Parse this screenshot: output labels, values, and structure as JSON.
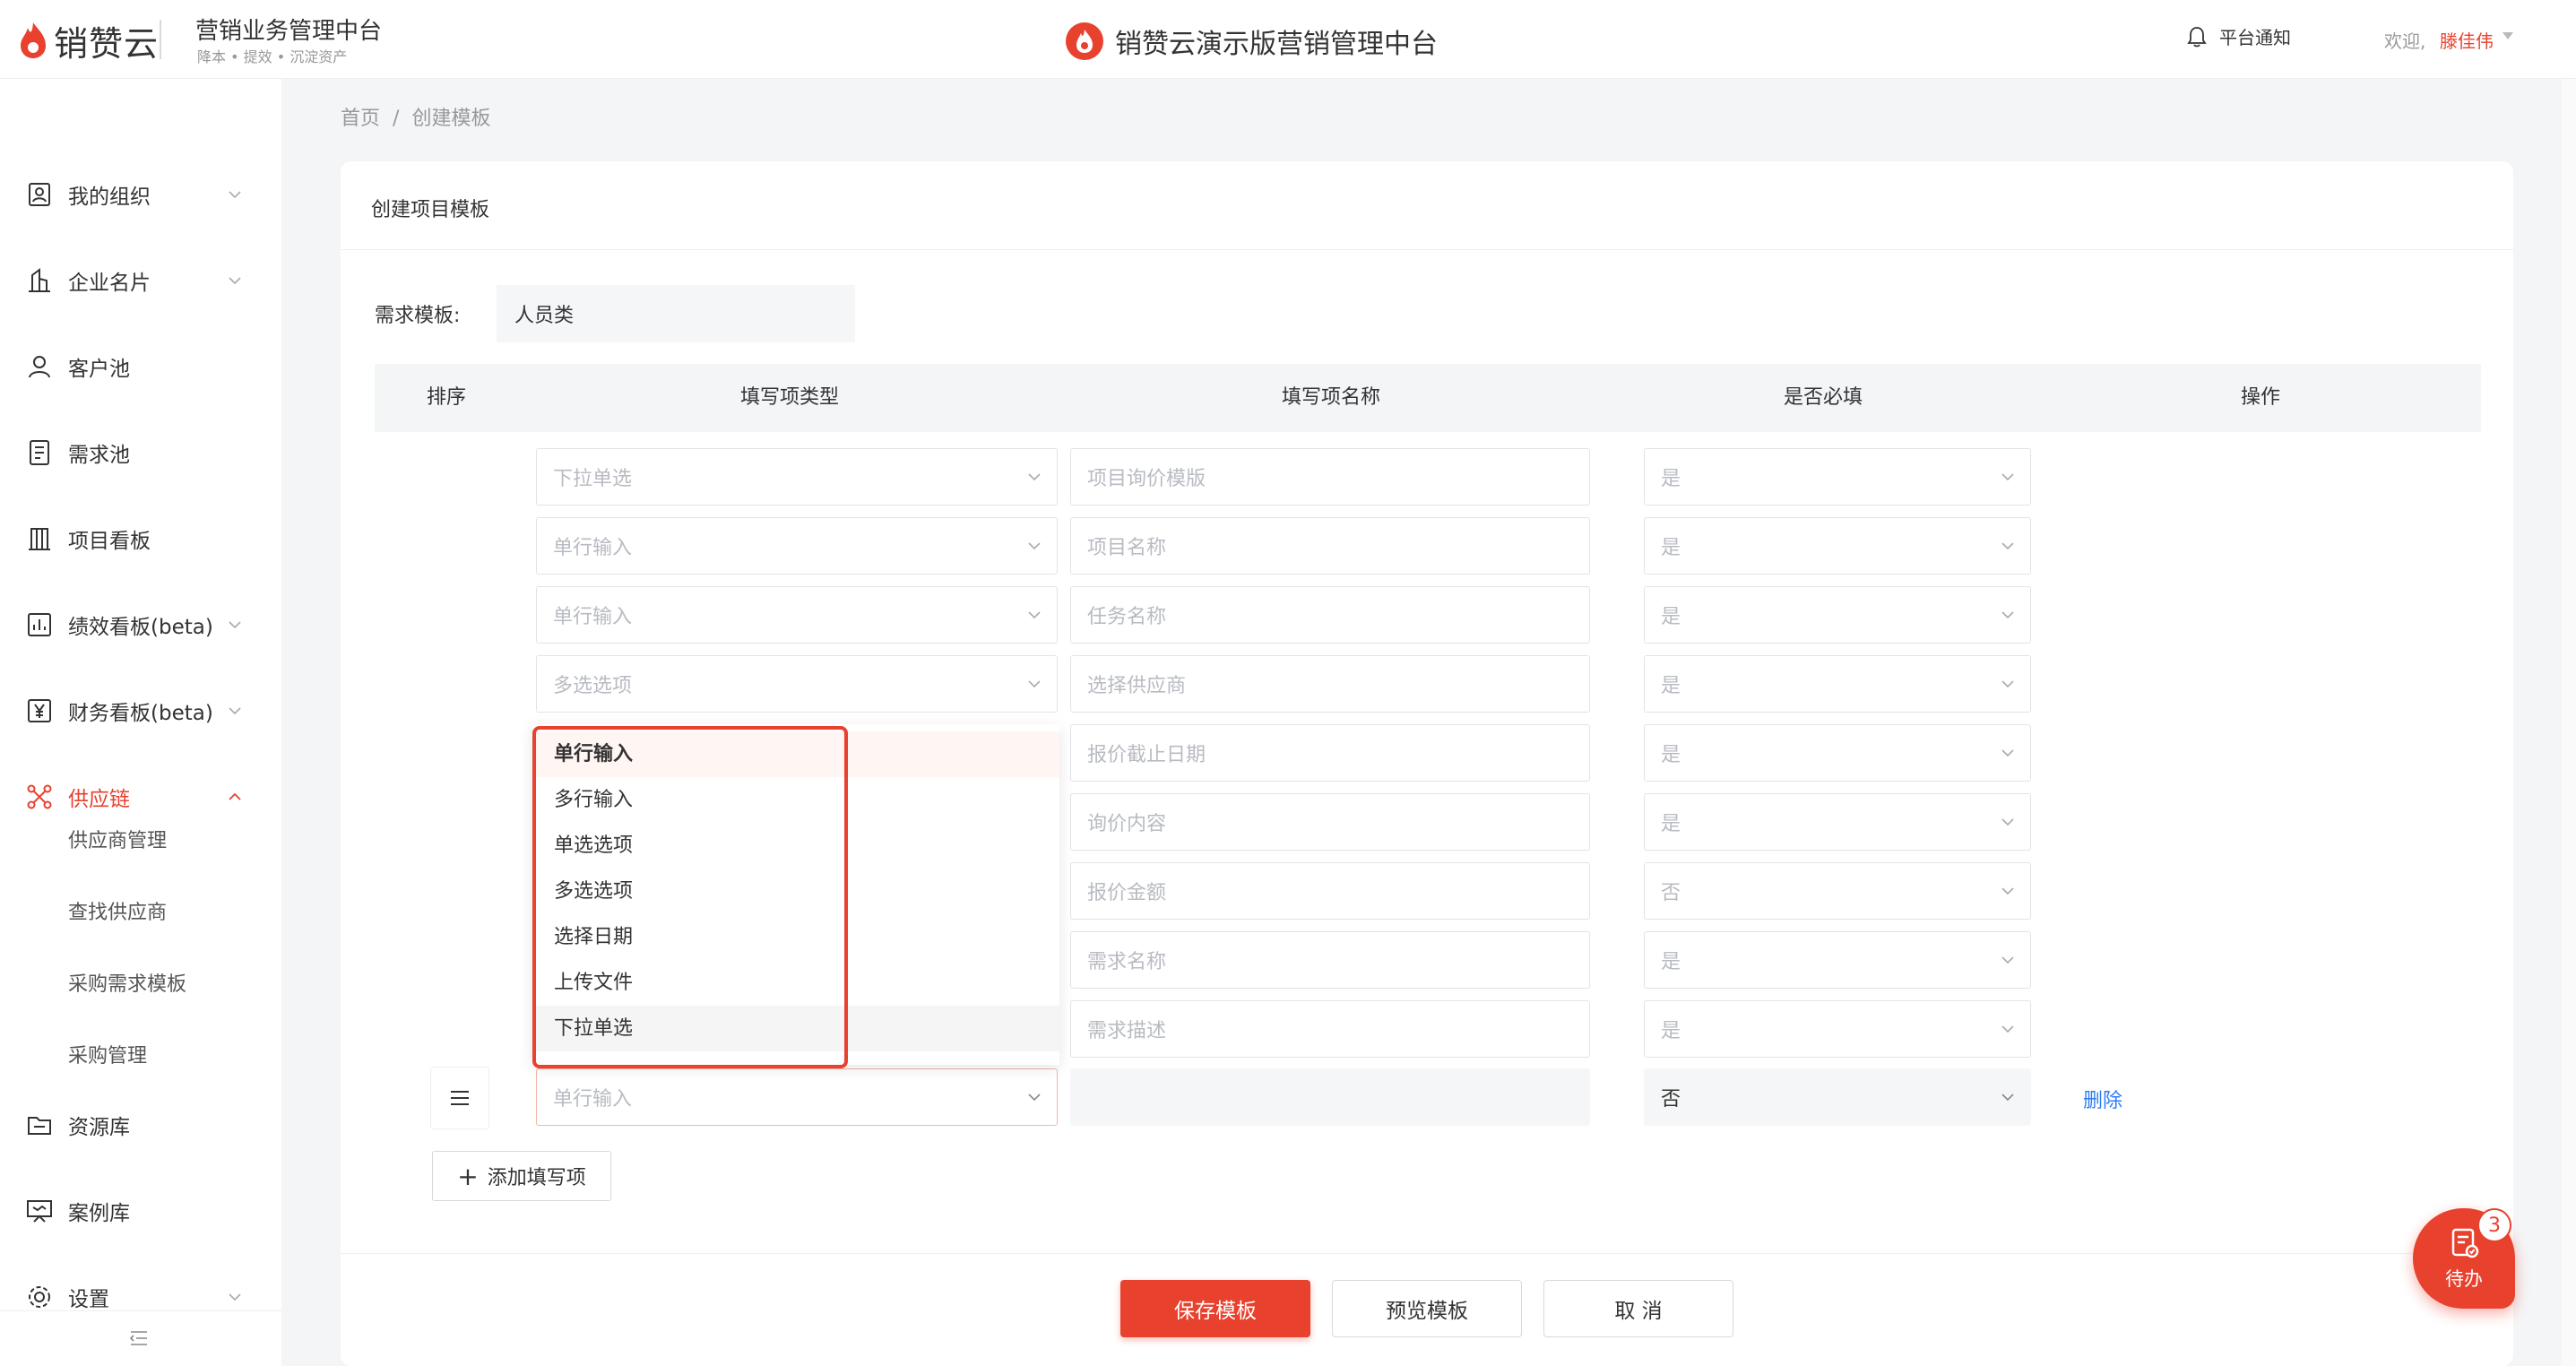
{
  "header": {
    "brand": "销赞云",
    "subtitle": "营销业务管理中台",
    "tags": "降本 • 提效 • 沉淀资产",
    "center_title": "销赞云演示版营销管理中台",
    "notify": "平台通知",
    "welcome": "欢迎,",
    "username": "滕佳伟"
  },
  "sidebar": {
    "items": [
      {
        "label": "我的组织",
        "icon": "org-icon"
      },
      {
        "label": "企业名片",
        "icon": "building-icon"
      },
      {
        "label": "客户池",
        "icon": "user-icon"
      },
      {
        "label": "需求池",
        "icon": "document-icon"
      },
      {
        "label": "项目看板",
        "icon": "board-icon"
      },
      {
        "label": "绩效看板(beta)",
        "icon": "chart-icon"
      },
      {
        "label": "财务看板(beta)",
        "icon": "yen-icon"
      },
      {
        "label": "供应链",
        "icon": "network-icon"
      },
      {
        "label": "资源库",
        "icon": "folder-icon"
      },
      {
        "label": "案例库",
        "icon": "presentation-icon"
      },
      {
        "label": "设置",
        "icon": "gear-icon"
      }
    ],
    "sub_items": [
      "供应商管理",
      "查找供应商",
      "采购需求模板",
      "采购管理"
    ]
  },
  "breadcrumb": {
    "home": "首页",
    "sep": "/",
    "current": "创建模板"
  },
  "card": {
    "title": "创建项目模板",
    "template_label": "需求模板:",
    "template_value": "人员类"
  },
  "table": {
    "headers": {
      "order": "排序",
      "type": "填写项类型",
      "name": "填写项名称",
      "required": "是否必填",
      "action": "操作"
    },
    "rows": [
      {
        "type": "下拉单选",
        "name": "项目询价模版",
        "required": "是"
      },
      {
        "type": "单行输入",
        "name": "项目名称",
        "required": "是"
      },
      {
        "type": "单行输入",
        "name": "任务名称",
        "required": "是"
      },
      {
        "type": "多选选项",
        "name": "选择供应商",
        "required": "是"
      },
      {
        "type": "",
        "name": "报价截止日期",
        "required": "是"
      },
      {
        "type": "",
        "name": "询价内容",
        "required": "是"
      },
      {
        "type": "",
        "name": "报价金额",
        "required": "否"
      },
      {
        "type": "",
        "name": "需求名称",
        "required": "是"
      },
      {
        "type": "",
        "name": "需求描述",
        "required": "是"
      }
    ],
    "new_row": {
      "type": "单行输入",
      "name": "",
      "required": "否",
      "delete": "删除"
    },
    "add_label": "添加填写项"
  },
  "dropdown": {
    "options": [
      "单行输入",
      "多行输入",
      "单选选项",
      "多选选项",
      "选择日期",
      "上传文件",
      "下拉单选"
    ]
  },
  "footer": {
    "save": "保存模板",
    "preview": "预览模板",
    "cancel": "取 消"
  },
  "todo": {
    "label": "待办",
    "count": "3"
  },
  "colors": {
    "accent": "#e8412e",
    "link": "#2e7cf6"
  }
}
